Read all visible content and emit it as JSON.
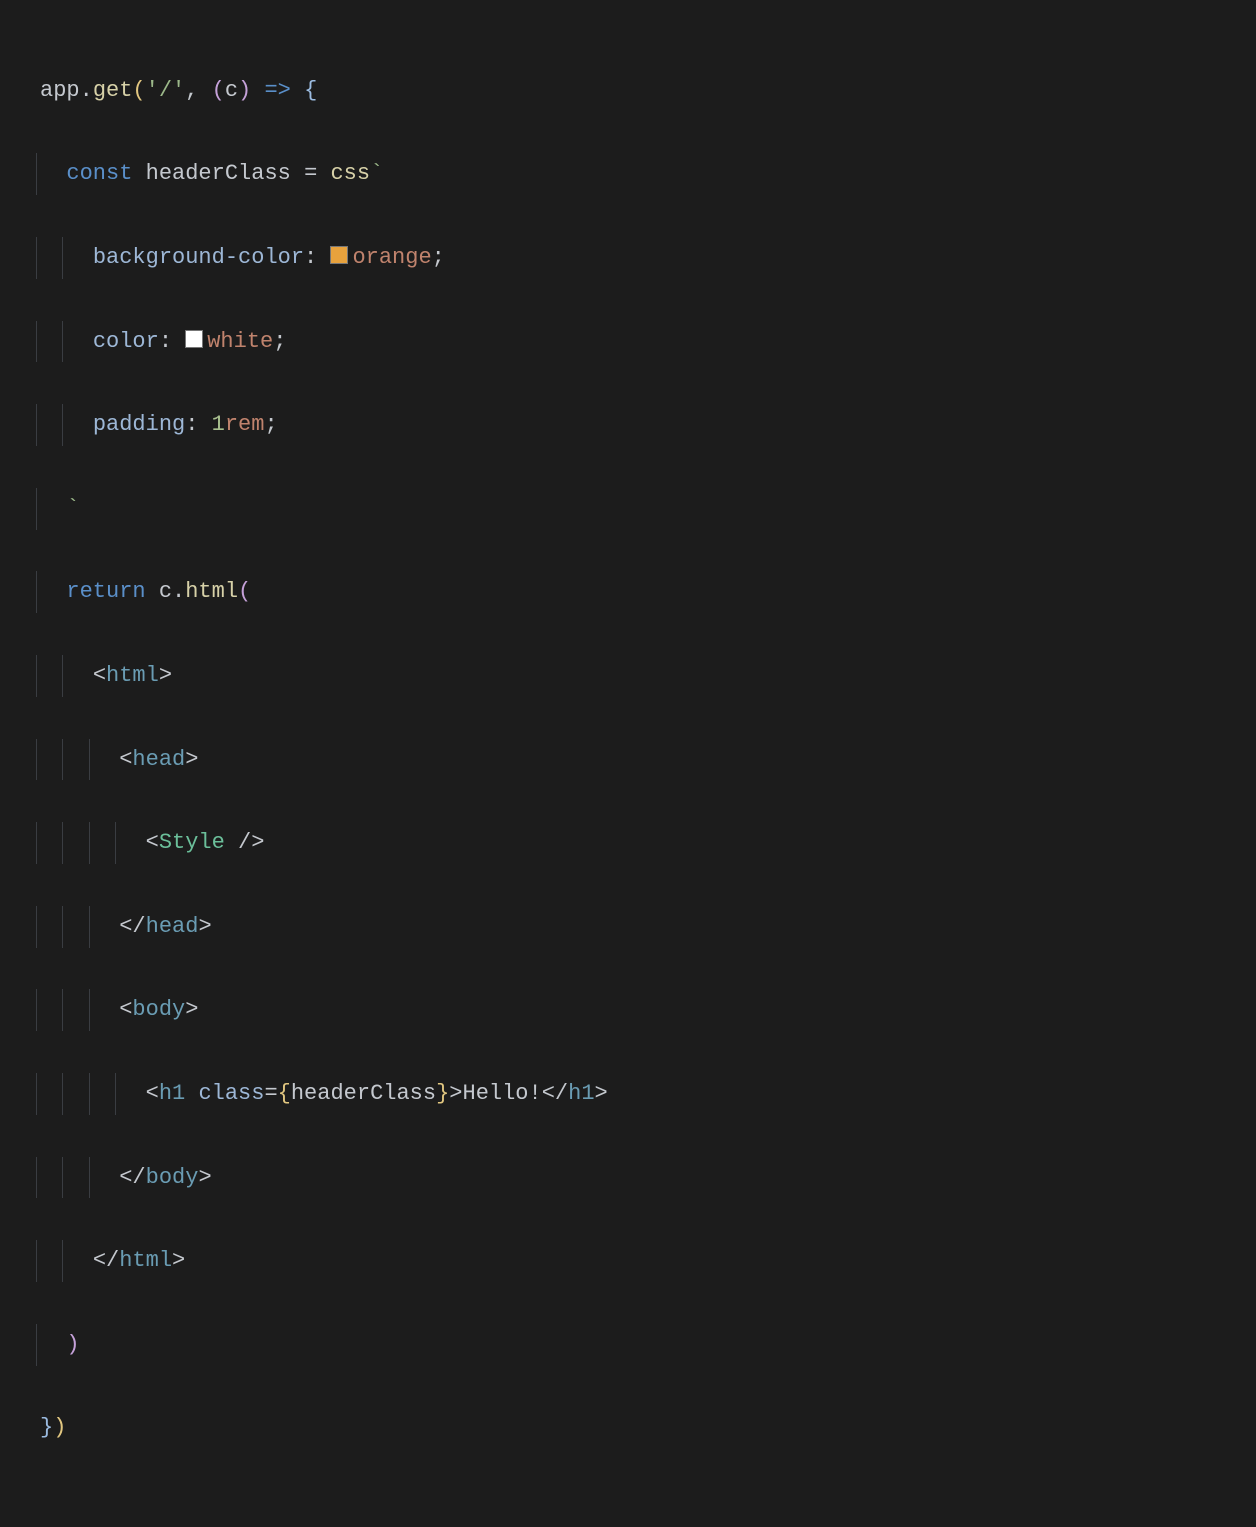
{
  "code": {
    "line1": {
      "app": "app",
      "dot1": ".",
      "get": "get",
      "open1": "(",
      "route": "'/'",
      "comma": ", ",
      "open2": "(",
      "param": "c",
      "close2": ")",
      "arrow": " => ",
      "brace": "{"
    },
    "line2": {
      "kw": "const",
      "var": " headerClass ",
      "eq": "= ",
      "css": "css",
      "tick": "`"
    },
    "line3": {
      "prop": "background-color",
      "colon": ": ",
      "val": "orange",
      "semi": ";"
    },
    "line4": {
      "prop": "color",
      "colon": ": ",
      "val": "white",
      "semi": ";"
    },
    "line5": {
      "prop": "padding",
      "colon": ": ",
      "num": "1",
      "unit": "rem",
      "semi": ";"
    },
    "line6": {
      "tick": "`"
    },
    "line7": {
      "kw": "return ",
      "c": "c",
      "dot": ".",
      "html": "html",
      "open": "("
    },
    "line8": {
      "lt": "<",
      "tag": "html",
      "gt": ">"
    },
    "line9": {
      "lt": "<",
      "tag": "head",
      "gt": ">"
    },
    "line10": {
      "lt": "<",
      "tag": "Style",
      "sl": " />"
    },
    "line11": {
      "lt": "</",
      "tag": "head",
      "gt": ">"
    },
    "line12": {
      "lt": "<",
      "tag": "body",
      "gt": ">"
    },
    "line13": {
      "lt": "<",
      "tag": "h1",
      "sp": " ",
      "attr": "class",
      "eq": "=",
      "bo": "{",
      "expr": "headerClass",
      "bc": "}",
      "gt": ">",
      "text": "Hello!",
      "clt": "</",
      "ctag": "h1",
      "cgt": ">"
    },
    "line14": {
      "lt": "</",
      "tag": "body",
      "gt": ">"
    },
    "line15": {
      "lt": "</",
      "tag": "html",
      "gt": ">"
    },
    "line16": {
      "close": ")"
    },
    "line17": {
      "brace": "}",
      "paren": ")"
    }
  },
  "swatches": {
    "orange": "#e8a23d",
    "white": "#ffffff"
  }
}
